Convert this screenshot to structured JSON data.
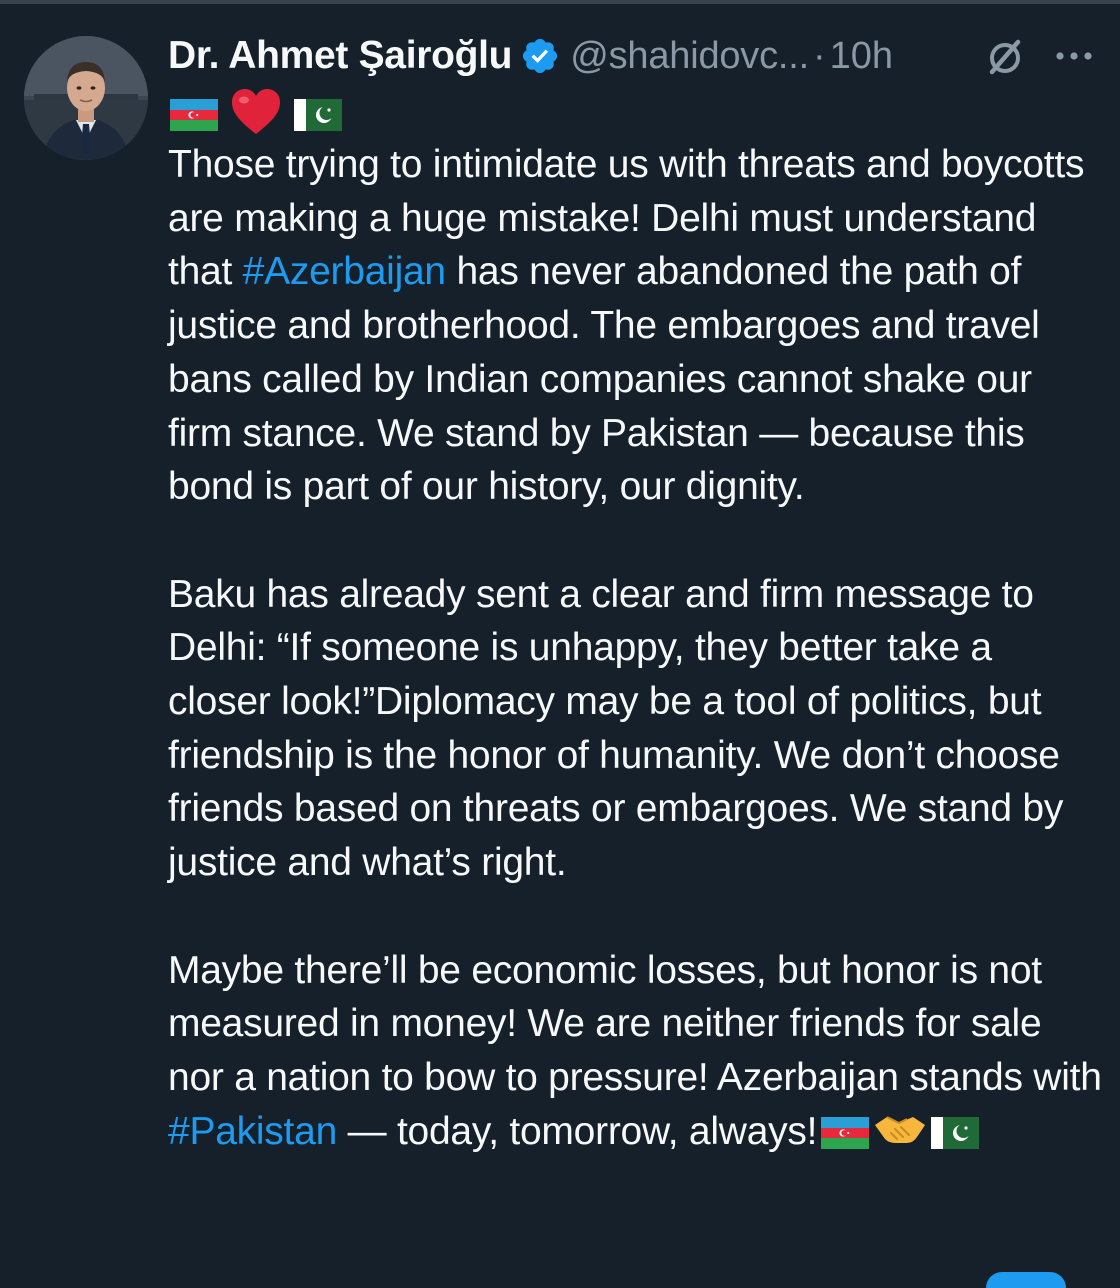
{
  "author": {
    "display_name": "Dr. Ahmet Şairoğlu",
    "handle": "@shahidovc...",
    "separator": "·",
    "timestamp": "10h",
    "verified": true
  },
  "colors": {
    "background": "#15202b",
    "text": "#f7f9f9",
    "muted": "#8b98a5",
    "link": "#1d9bf0",
    "verified_badge": "#1d9bf0"
  },
  "icons": {
    "verified": "verified-badge-icon",
    "grok": "grok-icon",
    "more": "more-options-icon"
  },
  "flag_row": [
    "azerbaijan-flag",
    "red-heart",
    "pakistan-flag"
  ],
  "tweet": {
    "p1": {
      "a": "Those trying to intimidate us with threats and boycotts are making a huge mistake! Delhi must understand that ",
      "hashtag": "#Azerbaijan",
      "b": " has never abandoned the path of justice and brotherhood. The embargoes and travel bans called by Indian companies cannot shake our firm stance. We stand by Pakistan — because this bond is part of our history, our dignity."
    },
    "p2": "Baku has already sent a clear and firm message to Delhi: “If someone is unhappy, they better take a closer look!”Diplomacy may be a tool of politics, but friendship is the honor of humanity. We don’t choose friends based on threats or embargoes. We stand by justice and what’s right.",
    "p3": {
      "a": "Maybe there’ll be economic losses, but honor is not measured in money! We are neither friends for sale nor a nation to bow to pressure! Azerbaijan stands with ",
      "hashtag": "#Pakistan",
      "b": " — today, tomorrow, always!"
    },
    "trailing_emojis": [
      "azerbaijan-flag",
      "handshake",
      "pakistan-flag"
    ]
  }
}
